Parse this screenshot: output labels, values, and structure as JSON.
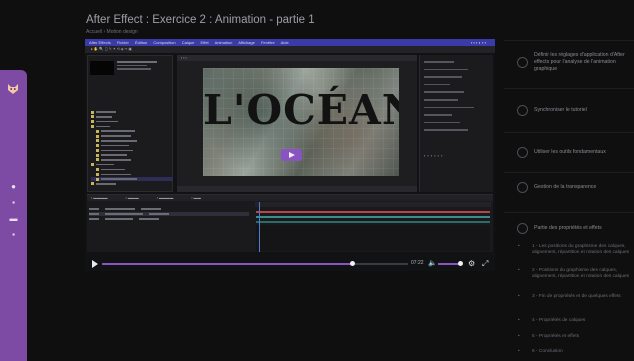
{
  "course": {
    "title": "After Effect : Exercice 2 : Animation - partie 1",
    "subtitle": "Accueil  ›  Motion design"
  },
  "sidebar": {
    "logo_icon": "fox-logo-icon",
    "items": [
      {
        "icon": "dot-icon"
      },
      {
        "icon": "grid-icon"
      },
      {
        "icon": "chat-icon"
      },
      {
        "icon": "person-icon"
      }
    ],
    "color": "#7d4aa4"
  },
  "video": {
    "canvas_text": "L'OCÉAN",
    "time": "07:22",
    "progress": 0.82,
    "accent": "#8a53c2"
  },
  "ae": {
    "menu": [
      "After Effects",
      "Fichier",
      "Édition",
      "Composition",
      "Calque",
      "Effet",
      "Animation",
      "Affichage",
      "Fenêtre",
      "Aide"
    ]
  },
  "outline": {
    "steps": [
      {
        "label": "Définir les réglages d'application d'After effects pour l'analyse de l'animation graphique"
      },
      {
        "label": "Synchroniser le tutoriel"
      },
      {
        "label": "Utiliser les outils fondamentaux"
      },
      {
        "label": "Gestion de la transparence"
      },
      {
        "label": "Partie des propriétés et effets"
      }
    ],
    "subitems": [
      "1 - Les positions du graphisme des calques, alignement, répartition et rotation des calques",
      "2 - Positions du graphisme des calques, alignement, répartition et rotation des calques",
      "3 - Fin de propriétés et de quelques effets",
      "4 - Propriétés de calques",
      "5 - Propriétés et effets",
      "6 - Conclusion"
    ]
  }
}
